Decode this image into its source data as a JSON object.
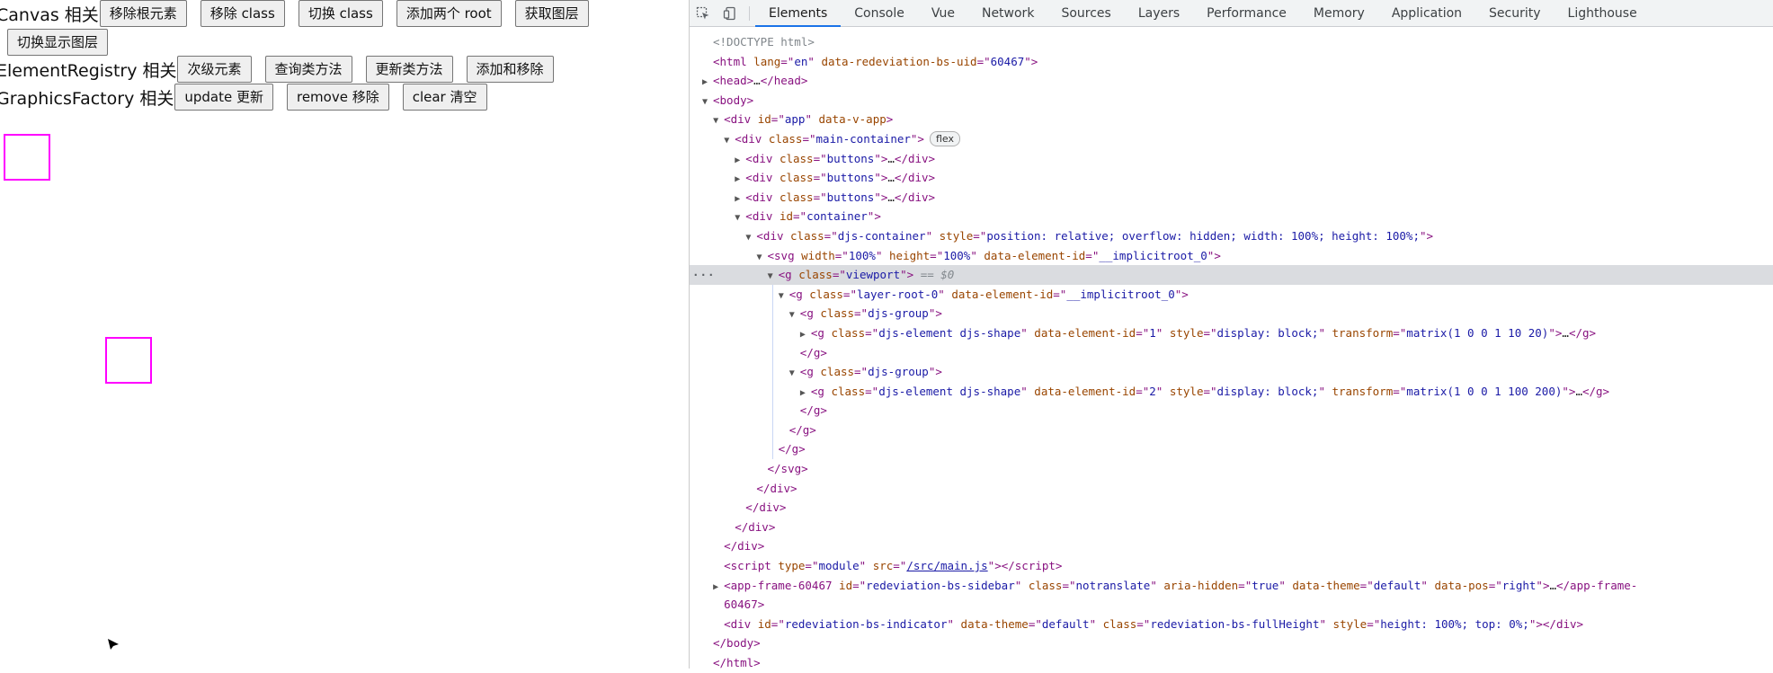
{
  "app": {
    "rows": [
      {
        "label": "Canvas 相关",
        "buttons": [
          "移除根元素",
          "移除 class",
          "切换 class",
          "添加两个 root",
          "获取图层"
        ]
      },
      {
        "label": "",
        "buttons": [
          "切换显示图层"
        ]
      },
      {
        "label": "ElementRegistry 相关",
        "buttons": [
          "次级元素",
          "查询类方法",
          "更新类方法",
          "添加和移除"
        ]
      },
      {
        "label": "GraphicsFactory 相关",
        "buttons": [
          "update 更新",
          "remove 移除",
          "clear 清空"
        ]
      }
    ],
    "shape_colors": {
      "stroke": "#ff00ff"
    }
  },
  "devtools": {
    "tabs": [
      "Elements",
      "Console",
      "Vue",
      "Network",
      "Sources",
      "Layers",
      "Performance",
      "Memory",
      "Application",
      "Security",
      "Lighthouse"
    ],
    "active_tab": "Elements",
    "icons": [
      "inspect-element-icon",
      "device-toolbar-icon"
    ],
    "tree": {
      "doctype": "<!DOCTYPE html>",
      "html_open": {
        "tag": "html",
        "attrs": [
          [
            "lang",
            "en"
          ],
          [
            "data-redeviation-bs-uid",
            "60467"
          ]
        ]
      },
      "head": {
        "tag": "head",
        "collapsed": "…"
      },
      "body_tag": "body",
      "app_div": {
        "tag": "div",
        "attrs": [
          [
            "id",
            "app"
          ],
          [
            "data-v-app",
            ""
          ]
        ]
      },
      "main_container": {
        "tag": "div",
        "attrs": [
          [
            "class",
            "main-container"
          ]
        ],
        "badge": "flex"
      },
      "buttons_div": {
        "tag": "div",
        "attrs": [
          [
            "class",
            "buttons"
          ]
        ],
        "collapsed": "…"
      },
      "container_div": {
        "tag": "div",
        "attrs": [
          [
            "id",
            "container"
          ]
        ]
      },
      "djs_container": {
        "tag": "div",
        "attrs": [
          [
            "class",
            "djs-container"
          ],
          [
            "style",
            "position: relative; overflow: hidden; width: 100%; height: 100%;"
          ]
        ]
      },
      "svg": {
        "tag": "svg",
        "attrs": [
          [
            "width",
            "100%"
          ],
          [
            "height",
            "100%"
          ],
          [
            "data-element-id",
            "__implicitroot_0"
          ]
        ]
      },
      "viewport": {
        "tag": "g",
        "attrs": [
          [
            "class",
            "viewport"
          ]
        ],
        "selected_marker": " == $0"
      },
      "layer_root": {
        "tag": "g",
        "attrs": [
          [
            "class",
            "layer-root-0"
          ],
          [
            "data-element-id",
            "__implicitroot_0"
          ]
        ]
      },
      "djs_group": {
        "tag": "g",
        "attrs": [
          [
            "class",
            "djs-group"
          ]
        ]
      },
      "shape1": {
        "tag": "g",
        "attrs": [
          [
            "class",
            "djs-element djs-shape"
          ],
          [
            "data-element-id",
            "1"
          ],
          [
            "style",
            "display: block;"
          ],
          [
            "transform",
            "matrix(1 0 0 1 10 20)"
          ]
        ],
        "collapsed": "…"
      },
      "shape2": {
        "tag": "g",
        "attrs": [
          [
            "class",
            "djs-element djs-shape"
          ],
          [
            "data-element-id",
            "2"
          ],
          [
            "style",
            "display: block;"
          ],
          [
            "transform",
            "matrix(1 0 0 1 100 200)"
          ]
        ],
        "collapsed": "…"
      },
      "script": {
        "tag": "script",
        "attrs": [
          [
            "type",
            "module"
          ],
          [
            "src",
            "/src/main.js"
          ]
        ]
      },
      "app_frame": {
        "tag": "app-frame-60467",
        "attrs": [
          [
            "id",
            "redeviation-bs-sidebar"
          ],
          [
            "class",
            "notranslate"
          ],
          [
            "aria-hidden",
            "true"
          ],
          [
            "data-theme",
            "default"
          ],
          [
            "data-pos",
            "right"
          ]
        ],
        "collapsed": "…",
        "close_wrap_1": "</app-frame-",
        "close_wrap_2": "60467>"
      },
      "indicator": {
        "tag": "div",
        "attrs": [
          [
            "id",
            "redeviation-bs-indicator"
          ],
          [
            "data-theme",
            "default"
          ],
          [
            "class",
            "redeviation-bs-fullHeight"
          ],
          [
            "style",
            "height: 100%; top: 0%;"
          ]
        ]
      }
    }
  }
}
